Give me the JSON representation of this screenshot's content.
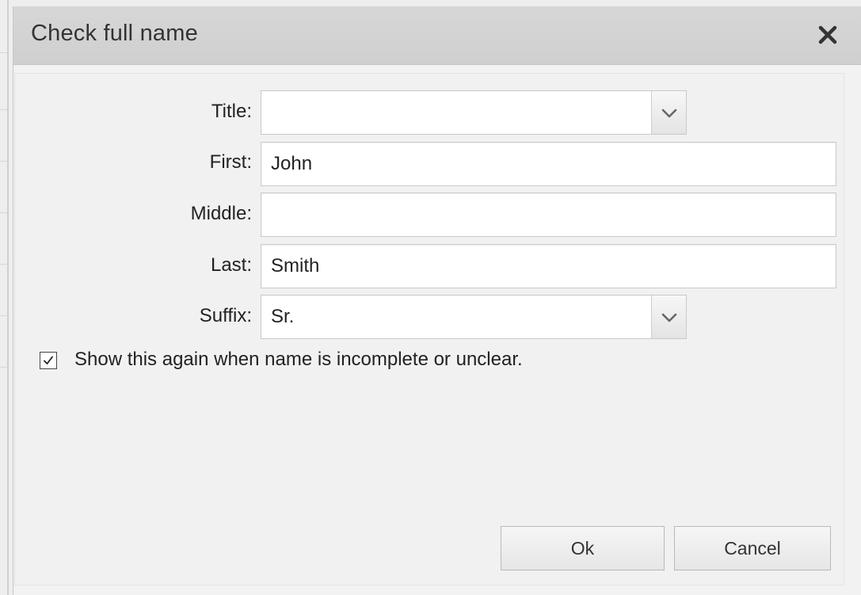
{
  "dialog": {
    "title": "Check full name",
    "close_icon": "close-icon"
  },
  "form": {
    "title": {
      "label": "Title:",
      "value": "",
      "icon": "chevron-down-icon"
    },
    "first": {
      "label": "First:",
      "value": "John"
    },
    "middle": {
      "label": "Middle:",
      "value": ""
    },
    "last": {
      "label": "Last:",
      "value": "Smith"
    },
    "suffix": {
      "label": "Suffix:",
      "value": "Sr.",
      "icon": "chevron-down-icon"
    }
  },
  "show_again": {
    "label": "Show this again when name is incomplete or unclear.",
    "checked": true
  },
  "buttons": {
    "ok": "Ok",
    "cancel": "Cancel"
  }
}
